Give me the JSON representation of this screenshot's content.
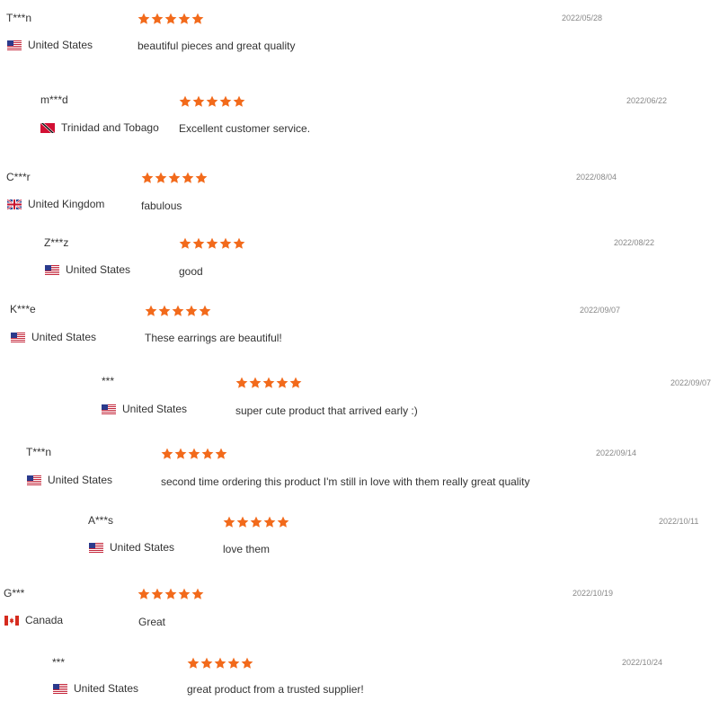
{
  "colors": {
    "star": "#f26a1b",
    "text": "#333333",
    "date": "#888888"
  },
  "rating_max": 5,
  "reviews": [
    {
      "user": "T***n",
      "country": "United States",
      "flag": "us-flag",
      "rating": 5,
      "text": "beautiful pieces and great quality",
      "date": "2022/05/28"
    },
    {
      "user": "m***d",
      "country": "Trinidad and Tobago",
      "flag": "tt-flag",
      "rating": 5,
      "text": "Excellent customer service.",
      "date": "2022/06/22"
    },
    {
      "user": "C***r",
      "country": "United Kingdom",
      "flag": "uk-flag",
      "rating": 5,
      "text": "fabulous",
      "date": "2022/08/04"
    },
    {
      "user": "Z***z",
      "country": "United States",
      "flag": "us-flag",
      "rating": 5,
      "text": "good",
      "date": "2022/08/22"
    },
    {
      "user": "K***e",
      "country": "United States",
      "flag": "us-flag",
      "rating": 5,
      "text": "These earrings are beautiful!",
      "date": "2022/09/07"
    },
    {
      "user": "***",
      "country": "United States",
      "flag": "us-flag",
      "rating": 5,
      "text": "super cute product that arrived early :)",
      "date": "2022/09/07"
    },
    {
      "user": "T***n",
      "country": "United States",
      "flag": "us-flag",
      "rating": 5,
      "text": "second time ordering this product I'm still in love with them really great quality",
      "date": "2022/09/14"
    },
    {
      "user": "A***s",
      "country": "United States",
      "flag": "us-flag",
      "rating": 5,
      "text": "love them",
      "date": "2022/10/11"
    },
    {
      "user": "G***",
      "country": "Canada",
      "flag": "ca-flag",
      "rating": 5,
      "text": "Great",
      "date": "2022/10/19"
    },
    {
      "user": "***",
      "country": "United States",
      "flag": "us-flag",
      "rating": 5,
      "text": "great product from a trusted supplier!",
      "date": "2022/10/24"
    }
  ]
}
